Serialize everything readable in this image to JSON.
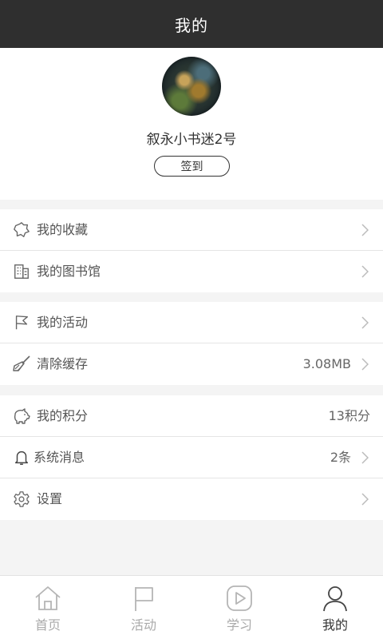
{
  "header": {
    "title": "我的"
  },
  "profile": {
    "username": "叙永小书迷2号",
    "checkin_label": "签到"
  },
  "menu": {
    "group1": [
      {
        "label": "我的收藏",
        "icon": "bookmark-icon",
        "value": ""
      },
      {
        "label": "我的图书馆",
        "icon": "library-icon",
        "value": ""
      }
    ],
    "group2": [
      {
        "label": "我的活动",
        "icon": "flag-icon",
        "value": ""
      },
      {
        "label": "清除缓存",
        "icon": "broom-icon",
        "value": "3.08MB"
      }
    ],
    "group3": [
      {
        "label": "我的积分",
        "icon": "piggy-bank-icon",
        "value": "13积分"
      },
      {
        "label": "系统消息",
        "icon": "bell-icon",
        "value": "2条"
      },
      {
        "label": "设置",
        "icon": "gear-icon",
        "value": ""
      }
    ]
  },
  "tabs": [
    {
      "label": "首页",
      "icon": "home-icon"
    },
    {
      "label": "活动",
      "icon": "flag-icon"
    },
    {
      "label": "学习",
      "icon": "play-icon"
    },
    {
      "label": "我的",
      "icon": "user-icon"
    }
  ],
  "colors": {
    "header_bg": "#2f2f2f",
    "active_tab": "#333333",
    "inactive_tab": "#aaaaaa"
  }
}
